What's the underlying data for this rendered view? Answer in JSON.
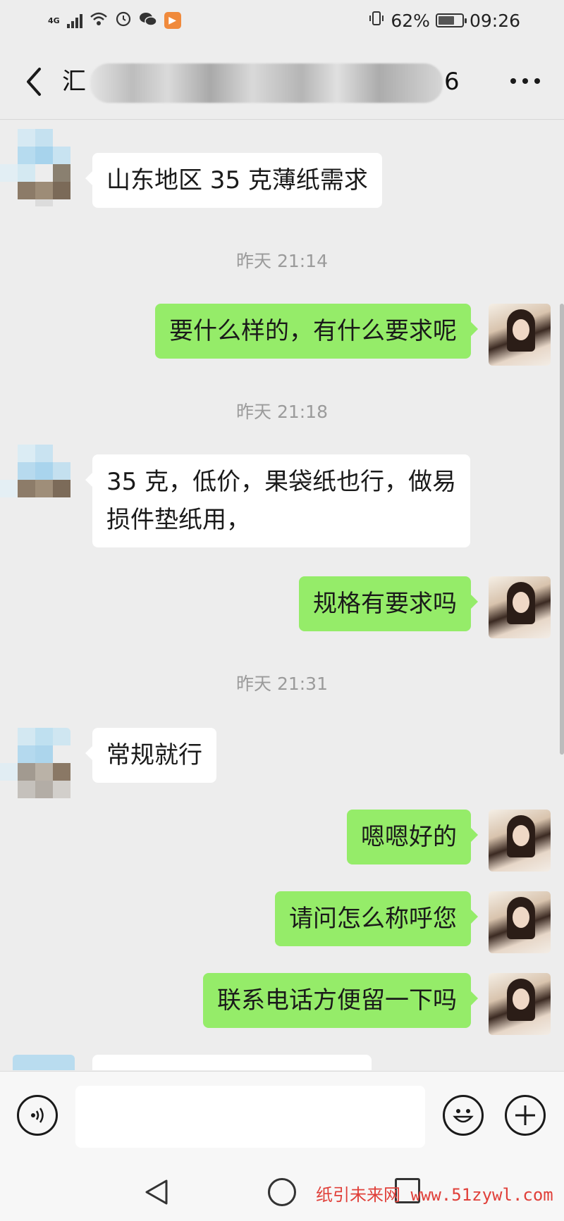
{
  "status_bar": {
    "network": "4G",
    "battery_percent": "62%",
    "time": "09:26",
    "icons": [
      "signal-icon",
      "wifi-icon",
      "alarm-icon",
      "wechat-icon",
      "app-badge-icon",
      "vibrate-icon",
      "battery-icon"
    ]
  },
  "header": {
    "title_start": "汇",
    "title_end": "6",
    "back_icon": "chevron-left-icon",
    "more_icon": "more-dots-icon"
  },
  "messages": [
    {
      "side": "in",
      "text": "山东地区 35 克薄纸需求"
    },
    {
      "type": "time",
      "text": "昨天 21:14"
    },
    {
      "side": "out",
      "text": "要什么样的，有什么要求呢"
    },
    {
      "type": "time",
      "text": "昨天 21:18"
    },
    {
      "side": "in",
      "lines": [
        "35 克，低价，果袋纸也行，做易",
        "损件垫纸用，"
      ]
    },
    {
      "side": "out",
      "text": "规格有要求吗"
    },
    {
      "type": "time",
      "text": "昨天 21:31"
    },
    {
      "side": "in",
      "text": "常规就行"
    },
    {
      "side": "out",
      "text": "嗯嗯好的"
    },
    {
      "side": "out",
      "text": "请问怎么称呼您"
    },
    {
      "side": "out",
      "text": "联系电话方便留一下吗"
    }
  ],
  "input_bar": {
    "input_value": "",
    "icons": [
      "voice-icon",
      "emoji-icon",
      "plus-icon"
    ]
  },
  "nav_bar": {
    "icons": [
      "nav-back-icon",
      "nav-home-icon",
      "nav-recent-icon"
    ]
  },
  "watermark": "纸引未来网 www.51zywl.com",
  "colors": {
    "background": "#ededed",
    "out_bubble": "#95ec69",
    "in_bubble": "#ffffff",
    "timestamp": "#9b9b9b",
    "watermark": "#e0403a"
  }
}
